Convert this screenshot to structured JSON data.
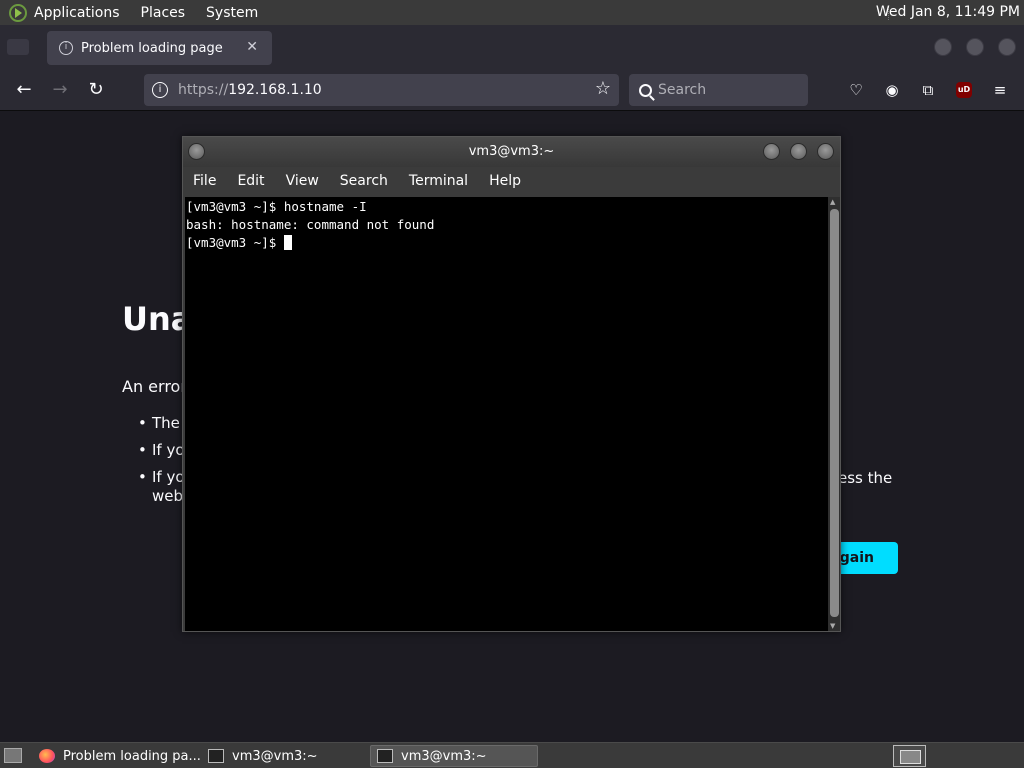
{
  "top_panel": {
    "menus": [
      "Applications",
      "Places",
      "System"
    ],
    "clock": "Wed Jan  8, 11:49 PM"
  },
  "browser": {
    "tab_title": "Problem loading page",
    "url_scheme": "https://",
    "url_host": "192.168.1.10",
    "search_placeholder": "Search"
  },
  "page": {
    "title_visible": "Una",
    "desc_visible": "An error",
    "bullets_visible": [
      "The",
      "If yo",
      "If yo"
    ],
    "bullet3_tail": "ess the",
    "bullet3_line2": "web.",
    "button_visible": "Again",
    "accent_color": "#00ddff"
  },
  "terminal": {
    "title": "vm3@vm3:~",
    "menus": [
      "File",
      "Edit",
      "View",
      "Search",
      "Terminal",
      "Help"
    ],
    "lines": [
      "[vm3@vm3 ~]$ hostname -I",
      "bash: hostname: command not found",
      "[vm3@vm3 ~]$ "
    ]
  },
  "taskbar": {
    "tasks": [
      "Problem loading pa...",
      "vm3@vm3:~",
      "vm3@vm3:~"
    ]
  }
}
